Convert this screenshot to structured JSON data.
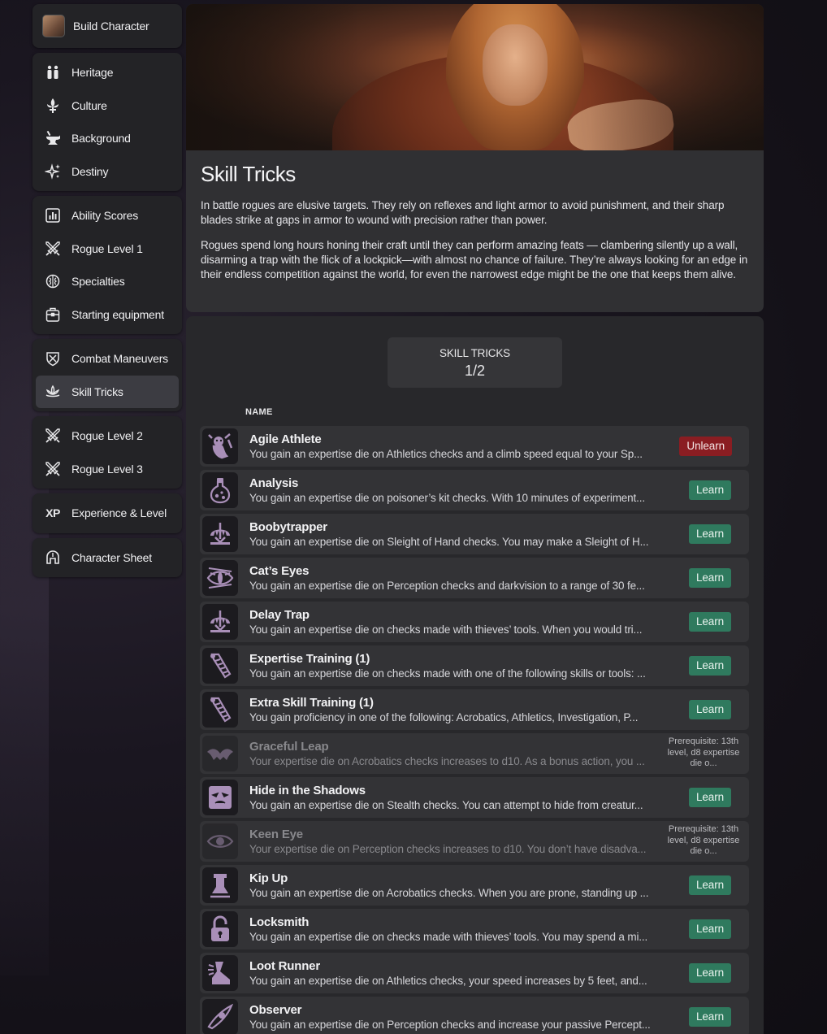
{
  "sidebar": {
    "header": {
      "label": "Build Character"
    },
    "groups": [
      [
        {
          "label": "Heritage",
          "icon": "heritage-icon"
        },
        {
          "label": "Culture",
          "icon": "fleur-de-lis-icon"
        },
        {
          "label": "Background",
          "icon": "anvil-icon"
        },
        {
          "label": "Destiny",
          "icon": "sparkles-icon"
        }
      ],
      [
        {
          "label": "Ability Scores",
          "icon": "bar-chart-icon"
        },
        {
          "label": "Rogue Level 1",
          "icon": "crossed-daggers-icon"
        },
        {
          "label": "Specialties",
          "icon": "brain-icon"
        },
        {
          "label": "Starting equipment",
          "icon": "backpack-icon"
        }
      ],
      [
        {
          "label": "Combat Maneuvers",
          "icon": "shield-icon"
        },
        {
          "label": "Skill Tricks",
          "icon": "lotus-icon",
          "active": true
        }
      ],
      [
        {
          "label": "Rogue Level 2",
          "icon": "crossed-daggers-icon"
        },
        {
          "label": "Rogue Level 3",
          "icon": "crossed-daggers-icon"
        }
      ],
      [
        {
          "label": "Experience & Level",
          "icon": "xp-icon",
          "icon_text": "XP"
        }
      ],
      [
        {
          "label": "Character Sheet",
          "icon": "helmet-icon"
        }
      ]
    ]
  },
  "hero": {
    "title": "Skill Tricks",
    "paragraphs": [
      "In battle rogues are elusive targets. They rely on reflexes and light armor to avoid punishment, and their sharp blades strike at gaps in armor to wound with precision rather than power.",
      "Rogues spend long hours honing their craft until they can perform amazing feats — clambering silently up a wall, disarming a trap with the flick of a lockpick—with almost no chance of failure. They’re always looking for an edge in their endless competition against the world, for even the narrowest edge might be the one that keeps them alive."
    ]
  },
  "counter": {
    "label": "SKILL TRICKS",
    "value": "1/2"
  },
  "list": {
    "column_header": "NAME",
    "rows": [
      {
        "name": "Agile Athlete",
        "desc": "You gain an expertise die on Athletics checks and a climb speed equal to your Sp...",
        "action": "Unlearn",
        "icon": "goblin-climber-icon"
      },
      {
        "name": "Analysis",
        "desc": "You gain an expertise die on poisoner’s kit checks. With 10 minutes of experiment...",
        "action": "Learn",
        "icon": "potion-flask-icon"
      },
      {
        "name": "Boobytrapper",
        "desc": "You gain an expertise die on Sleight of Hand checks. You may make a Sleight of H...",
        "action": "Learn",
        "icon": "trap-icon"
      },
      {
        "name": "Cat’s Eyes",
        "desc": "You gain an expertise die on Perception checks and darkvision to a range of 30 fe...",
        "action": "Learn",
        "icon": "cat-eye-icon"
      },
      {
        "name": "Delay Trap",
        "desc": "You gain an expertise die on checks made with thieves’ tools. When you would tri...",
        "action": "Learn",
        "icon": "trap-icon"
      },
      {
        "name": "Expertise Training (1)",
        "desc": "You gain an expertise die on checks made with one of the following skills or tools: ...",
        "action": "Learn",
        "icon": "scroll-icon"
      },
      {
        "name": "Extra Skill Training (1)",
        "desc": "You gain proficiency in one of the following: Acrobatics, Athletics, Investigation, P...",
        "action": "Learn",
        "icon": "scroll-icon"
      },
      {
        "name": "Graceful Leap",
        "desc": "Your expertise die on Acrobatics checks increases to d10. As a bonus action, you ...",
        "action": "",
        "prereq": "Prerequisite: 13th level, d8 expertise die o...",
        "icon": "bat-wings-icon",
        "dim": true
      },
      {
        "name": "Hide in the Shadows",
        "desc": "You gain an expertise die on Stealth checks. You can attempt to hide from creatur...",
        "action": "Learn",
        "icon": "shadow-face-icon"
      },
      {
        "name": "Keen Eye",
        "desc": "Your expertise die on Perception checks increases to d10. You don’t have disadva...",
        "action": "",
        "prereq": "Prerequisite: 13th level, d8 expertise die o...",
        "icon": "eye-icon",
        "dim": true
      },
      {
        "name": "Kip Up",
        "desc": "You gain an expertise die on Acrobatics checks. When you are prone, standing up ...",
        "action": "Learn",
        "icon": "boot-spring-icon"
      },
      {
        "name": "Locksmith",
        "desc": "You gain an expertise die on checks made with thieves’ tools. You may spend a mi...",
        "action": "Learn",
        "icon": "padlock-icon"
      },
      {
        "name": "Loot Runner",
        "desc": "You gain an expertise die on Athletics checks, your speed increases by 5 feet, and...",
        "action": "Learn",
        "icon": "winged-boot-icon"
      },
      {
        "name": "Observer",
        "desc": "You gain an expertise die on Perception checks and increase your passive Percept...",
        "action": "Learn",
        "icon": "observer-eye-icon"
      }
    ]
  },
  "colors": {
    "learn": "#2f7a5e",
    "unlearn": "#8a1d22",
    "icon_purple": "#a98fb8"
  }
}
